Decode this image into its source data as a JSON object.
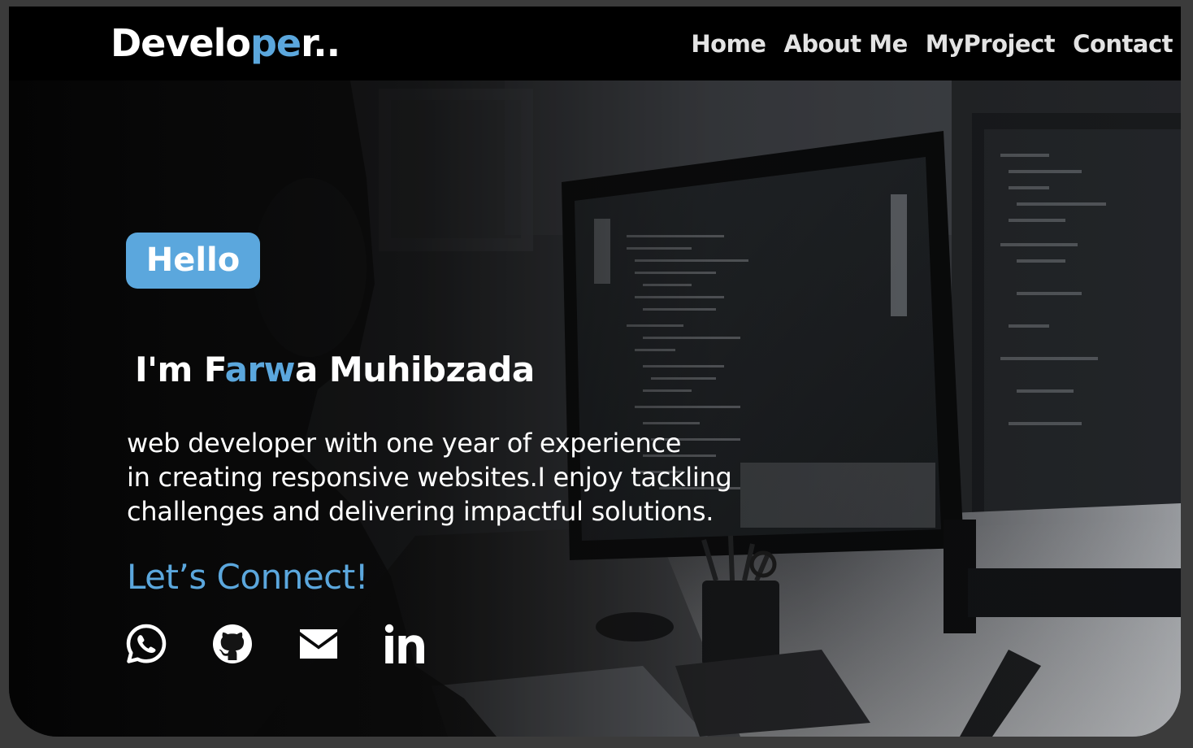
{
  "logo": {
    "part1": "Develo",
    "part2": "pe",
    "part3": "r.."
  },
  "nav": {
    "items": [
      {
        "label": "Home"
      },
      {
        "label": "About Me"
      },
      {
        "label": "MyProject"
      },
      {
        "label": "Contact"
      }
    ]
  },
  "hero": {
    "hello": "Hello",
    "name": {
      "part1": "I'm F",
      "part2": "arw",
      "part3": "a Muhibzada"
    },
    "bio_lines": [
      "web developer with one year of experience",
      "in creating responsive websites.I enjoy tackling",
      "challenges and delivering impactful solutions."
    ],
    "connect": "Let’s Connect!"
  },
  "socials": [
    {
      "icon": "whatsapp-icon"
    },
    {
      "icon": "github-icon"
    },
    {
      "icon": "email-icon"
    },
    {
      "icon": "linkedin-icon"
    }
  ],
  "colors": {
    "accent": "#5ba7dd",
    "navbar_bg": "#000000",
    "text": "#ffffff"
  }
}
